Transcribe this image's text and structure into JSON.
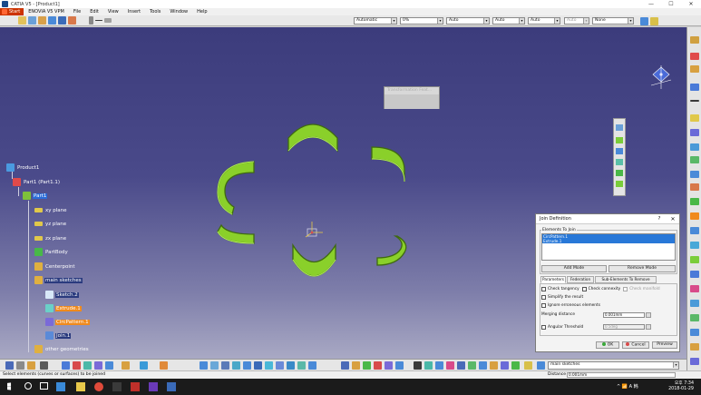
{
  "window": {
    "title": "CATIA V5 - [Product1]",
    "minimize": "—",
    "maximize": "☐",
    "close": "✕"
  },
  "menu": {
    "start": "Start",
    "items": [
      "ENOVIA V5 VPM",
      "File",
      "Edit",
      "View",
      "Insert",
      "Tools",
      "Window",
      "Help"
    ]
  },
  "toolbar": {
    "combo1": "Automatic",
    "combo2": "0%",
    "combo3": "Auto",
    "combo4": "Auto",
    "combo5": "Auto",
    "combo6": "Auto",
    "combo7": "None"
  },
  "tree": {
    "root": "Product1",
    "part_instance": "Part1 (Part1.1)",
    "part": "Part1",
    "xy": "xy plane",
    "yz": "yz plane",
    "zx": "zx plane",
    "body": "PartBody",
    "centerpoint": "Centerpoint",
    "main_sketches": "main sketches",
    "sketch2": "Sketch.2",
    "extrude1": "Extrude.1",
    "circpattern1": "CircPattern.1",
    "join1": "Join.1",
    "other": "other geometries"
  },
  "floating": {
    "transform_title": "Transformation Feat..."
  },
  "dialog": {
    "title": "Join Definition",
    "help": "?",
    "close": "✕",
    "elements_label": "Elements To Join",
    "elements": [
      "CircPattern.1",
      "Extrude.1"
    ],
    "add_mode": "Add Mode",
    "remove_mode": "Remove Mode",
    "tabs": [
      "Parameters",
      "Federation",
      "Sub-Elements To Remove"
    ],
    "check_tangency": "Check tangency",
    "check_connexity": "Check connexity",
    "check_manifold": "Check manifold",
    "simplify": "Simplify the result",
    "ignore": "Ignore erroneous elements",
    "merging_label": "Merging distance",
    "merging_value": "0.001mm",
    "angular_label": "Angular Threshold",
    "angular_value": "0.5deg",
    "ok": "OK",
    "cancel": "Cancel",
    "preview": "Preview"
  },
  "bottom": {
    "sketch_combo": "main sketches"
  },
  "status": {
    "message": "Select elements (curves or surfaces) to be joined",
    "distance_label": "Distance",
    "distance_value": "0.001mm"
  },
  "taskbar": {
    "tray": "^ 📶 A 韩",
    "time": "오후 7:34",
    "date": "2018-01-29"
  },
  "colors": {
    "viewport_top": "#3c3c7c",
    "viewport_bottom": "#a9a9c4",
    "shape_fill": "#7fcc1a",
    "shape_edge": "#4a7a10",
    "selection_blue": "#2878d8",
    "selection_orange": "#f08a1c"
  }
}
